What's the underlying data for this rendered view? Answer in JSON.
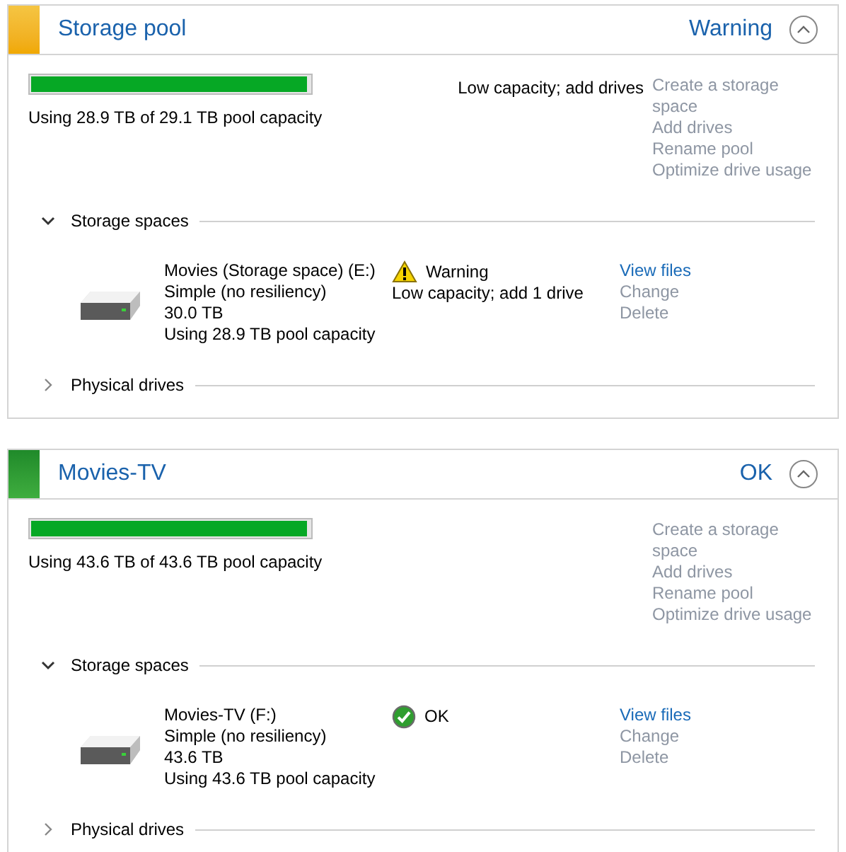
{
  "pools": [
    {
      "title": "Storage pool",
      "status": "Warning",
      "kind": "warning",
      "level": 0.99,
      "usage": "Using 28.9 TB of 29.1 TB pool capacity",
      "notice": "Low capacity; add drives",
      "actions": [
        {
          "label": "Create a storage space",
          "disabled": true
        },
        {
          "label": "Add drives",
          "disabled": true
        },
        {
          "label": "Rename pool",
          "disabled": true
        },
        {
          "label": "Optimize drive usage",
          "disabled": true
        }
      ],
      "sections": [
        {
          "label": "Storage spaces",
          "expanded": true,
          "spaces": [
            {
              "name": "Movies (Storage space) (E:)",
              "type": "Simple (no resiliency)",
              "size": "30.0 TB",
              "usage": "Using 28.9 TB pool capacity",
              "status": "Warning",
              "kind": "warning",
              "status_detail": "Low capacity; add 1 drive",
              "actions": [
                {
                  "label": "View files",
                  "disabled": false
                },
                {
                  "label": "Change",
                  "disabled": true
                },
                {
                  "label": "Delete",
                  "disabled": true
                }
              ]
            }
          ]
        },
        {
          "label": "Physical drives",
          "expanded": false
        }
      ]
    },
    {
      "title": "Movies-TV",
      "status": "OK",
      "kind": "ok",
      "level": 0.99,
      "usage": "Using 43.6 TB of 43.6 TB pool capacity",
      "actions": [
        {
          "label": "Create a storage space",
          "disabled": true
        },
        {
          "label": "Add drives",
          "disabled": true
        },
        {
          "label": "Rename pool",
          "disabled": true
        },
        {
          "label": "Optimize drive usage",
          "disabled": true
        }
      ],
      "sections": [
        {
          "label": "Storage spaces",
          "expanded": true,
          "spaces": [
            {
              "name": "Movies-TV (F:)",
              "type": "Simple (no resiliency)",
              "size": "43.6 TB",
              "usage": "Using 43.6 TB pool capacity",
              "status": "OK",
              "kind": "ok",
              "actions": [
                {
                  "label": "View files",
                  "disabled": false
                },
                {
                  "label": "Change",
                  "disabled": true
                },
                {
                  "label": "Delete",
                  "disabled": true
                }
              ]
            }
          ]
        },
        {
          "label": "Physical drives",
          "expanded": false
        }
      ]
    }
  ]
}
